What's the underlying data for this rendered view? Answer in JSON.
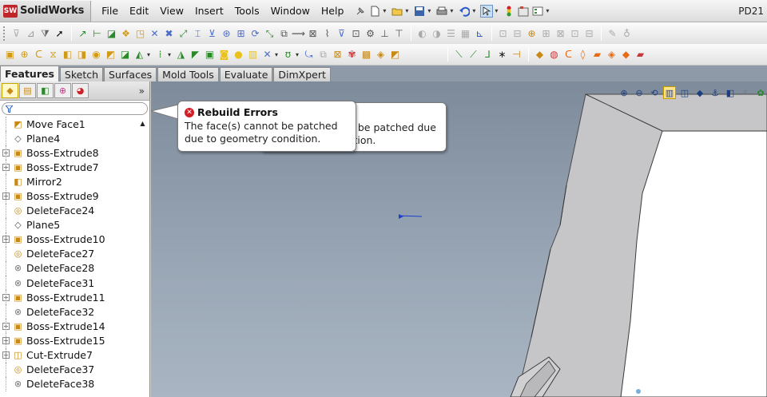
{
  "app": {
    "logo_mark": "SW",
    "logo_text": "SolidWorks",
    "document_title": "PD21"
  },
  "menu": {
    "items": [
      "File",
      "Edit",
      "View",
      "Insert",
      "Tools",
      "Window",
      "Help"
    ]
  },
  "command_manager": {
    "tabs": [
      "Features",
      "Sketch",
      "Surfaces",
      "Mold Tools",
      "Evaluate",
      "DimXpert"
    ],
    "active_tab": "Features"
  },
  "feature_manager": {
    "more_label": "»",
    "filter_icon": "funnel-icon",
    "tree": [
      {
        "label": "Move Face1",
        "icon": "move-face-icon",
        "expandable": false
      },
      {
        "label": "Plane4",
        "icon": "plane-icon",
        "expandable": false
      },
      {
        "label": "Boss-Extrude8",
        "icon": "boss-extrude-icon",
        "expandable": true
      },
      {
        "label": "Boss-Extrude7",
        "icon": "boss-extrude-icon",
        "expandable": true
      },
      {
        "label": "Mirror2",
        "icon": "mirror-icon",
        "expandable": false
      },
      {
        "label": "Boss-Extrude9",
        "icon": "boss-extrude-icon",
        "expandable": true
      },
      {
        "label": "DeleteFace24",
        "icon": "delete-face-icon",
        "expandable": false
      },
      {
        "label": "Plane5",
        "icon": "plane-icon",
        "expandable": false
      },
      {
        "label": "Boss-Extrude10",
        "icon": "boss-extrude-icon",
        "expandable": true
      },
      {
        "label": "DeleteFace27",
        "icon": "delete-face-icon",
        "expandable": false
      },
      {
        "label": "DeleteFace28",
        "icon": "delete-face-error-icon",
        "expandable": false
      },
      {
        "label": "DeleteFace31",
        "icon": "delete-face-error-icon",
        "expandable": false
      },
      {
        "label": "Boss-Extrude11",
        "icon": "boss-extrude-icon",
        "expandable": true
      },
      {
        "label": "DeleteFace32",
        "icon": "delete-face-error-icon",
        "expandable": false
      },
      {
        "label": "Boss-Extrude14",
        "icon": "boss-extrude-icon",
        "expandable": true
      },
      {
        "label": "Boss-Extrude15",
        "icon": "boss-extrude-icon",
        "expandable": true
      },
      {
        "label": "Cut-Extrude7",
        "icon": "cut-extrude-icon",
        "expandable": true
      },
      {
        "label": "DeleteFace37",
        "icon": "delete-face-icon",
        "expandable": false
      },
      {
        "label": "DeleteFace38",
        "icon": "delete-face-error-icon",
        "expandable": false
      }
    ]
  },
  "rebuild_errors": {
    "title": "Rebuild Errors",
    "message": "The face(s) cannot be patched due to geometry condition.",
    "shadow_title_fragment": "s",
    "shadow_line1_fragment": "t be patched due",
    "shadow_line2_fragment": "ition."
  },
  "colors": {
    "viewport_top": "#7e8b9b",
    "viewport_bottom": "#a9b5c2",
    "error_red": "#d21e26",
    "model_face": "#c6c6c8",
    "model_inner": "#ffffff"
  }
}
